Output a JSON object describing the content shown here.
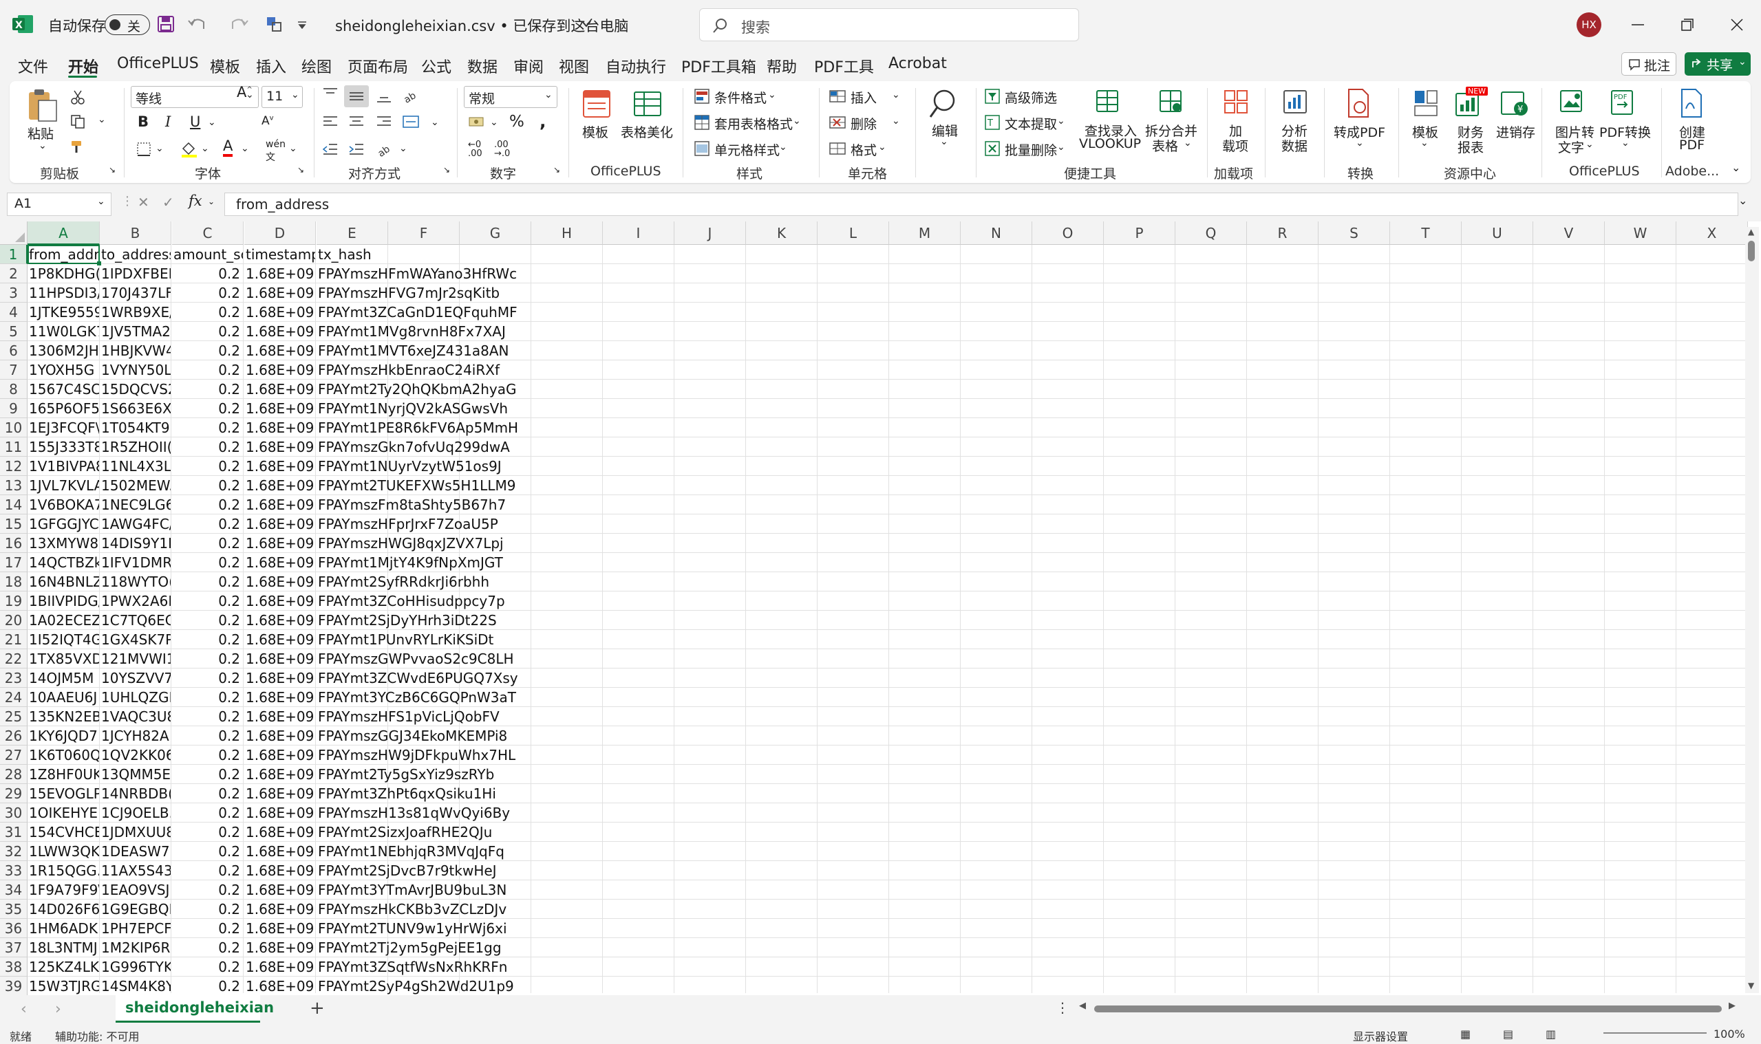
{
  "titlebar": {
    "autosave_label": "自动保存",
    "autosave_state": "关",
    "filename": "sheidongleheixian.csv • 已保存到这台电脑",
    "search_placeholder": "搜索",
    "user_initials": "HX"
  },
  "menu": {
    "items": [
      "文件",
      "开始",
      "OfficePLUS",
      "模板",
      "插入",
      "绘图",
      "页面布局",
      "公式",
      "数据",
      "审阅",
      "视图",
      "自动执行",
      "PDF工具箱",
      "帮助",
      "PDF工具",
      "Acrobat"
    ],
    "active": "开始",
    "comment_label": "批注",
    "share_label": "共享"
  },
  "ribbon": {
    "clipboard": {
      "paste": "粘贴",
      "group": "剪贴板"
    },
    "font": {
      "name": "等线",
      "size": "11",
      "group": "字体"
    },
    "alignment": {
      "group": "对齐方式"
    },
    "number": {
      "format": "常规",
      "group": "数字"
    },
    "officeplus1": {
      "template": "模板",
      "beautify": "表格美化",
      "group": "OfficePLUS"
    },
    "styles": {
      "conditional": "条件格式",
      "table_format": "套用表格格式",
      "cell_style": "单元格样式",
      "group": "样式"
    },
    "cells": {
      "insert": "插入",
      "delete": "删除",
      "format": "格式",
      "group": "单元格"
    },
    "editing": {
      "edit": "编辑"
    },
    "quicktools": {
      "adv_filter": "高级筛选",
      "text_extract": "文本提取",
      "batch_delete": "批量删除",
      "vlookup_1": "查找录入",
      "vlookup_2": "VLOOKUP",
      "split_1": "拆分合并",
      "split_2": "表格",
      "group": "便捷工具"
    },
    "addins": {
      "label_1": "加",
      "label_2": "载项",
      "group": "加载项"
    },
    "analyze": {
      "label_1": "分析",
      "label_2": "数据"
    },
    "convert": {
      "pdf": "转成PDF",
      "group": "转换"
    },
    "resources": {
      "template": "模板",
      "finance_1": "财务",
      "finance_2": "报表",
      "invoice": "进销存",
      "new_badge": "NEW",
      "group": "资源中心"
    },
    "officeplus2": {
      "img_1": "图片转",
      "img_2": "文字",
      "pdf_convert": "PDF转换",
      "group": "OfficePLUS"
    },
    "adobe": {
      "create_1": "创建",
      "create_2": "PDF",
      "group": "Adobe..."
    }
  },
  "formula_bar": {
    "name_box": "A1",
    "fx": "fx",
    "content": "from_address"
  },
  "columns": [
    "A",
    "B",
    "C",
    "D",
    "E",
    "F",
    "G",
    "H",
    "I",
    "J",
    "K",
    "L",
    "M",
    "N",
    "O",
    "P",
    "Q",
    "R",
    "S",
    "T",
    "U",
    "V",
    "W",
    "X"
  ],
  "table": {
    "headers": [
      "from_addr",
      "to_address",
      "amount_sc",
      "timestamp",
      "tx_hash"
    ],
    "rows": [
      [
        "1P8KDHG(",
        "1IPDXFBEF",
        "0.2",
        "1.68E+09",
        "FPAYmszHFmWAYano3HfRWc"
      ],
      [
        "11HPSDI3/",
        "170J437LF",
        "0.2",
        "1.68E+09",
        "FPAYmszHFVG7mJr2sqKitb"
      ],
      [
        "1JTKE9559",
        "1WRB9XE/",
        "0.2",
        "1.68E+09",
        "FPAYmt3ZCaGnD1EQFquhMF"
      ],
      [
        "11W0LGK7",
        "1JV5TMA2",
        "0.2",
        "1.68E+09",
        "FPAYmt1MVg8rvnH8Fx7XAJ"
      ],
      [
        "1306M2JH",
        "1HBJKVW4",
        "0.2",
        "1.68E+09",
        "FPAYmt1MVT6xeJZ431a8AN"
      ],
      [
        "1YOXH5G",
        "1VYNY50L",
        "0.2",
        "1.68E+09",
        "FPAYmszHkbEnraoC24iRXf"
      ],
      [
        "1567C4SC",
        "15DQCVS2",
        "0.2",
        "1.68E+09",
        "FPAYmt2Ty2QhQKbmA2hyaG"
      ],
      [
        "165P6OF5",
        "1S663E6X",
        "0.2",
        "1.68E+09",
        "FPAYmt1NyrjQV2kASGwsVh"
      ],
      [
        "1EJ3FCQF\\",
        "1T054KT93",
        "0.2",
        "1.68E+09",
        "FPAYmt1PE8R6kFV6Ap5MmH"
      ],
      [
        "155J333T8",
        "1R5ZHOII(",
        "0.2",
        "1.68E+09",
        "FPAYmszGkn7ofvUq299dwA"
      ],
      [
        "1V1BIVPA8",
        "11NL4X3L",
        "0.2",
        "1.68E+09",
        "FPAYmt1NUyrVzytW51os9J"
      ],
      [
        "1JVL7KVLA",
        "1502MEW.",
        "0.2",
        "1.68E+09",
        "FPAYmt2TUKEFXWs5H1LLM9"
      ],
      [
        "1V6BOKA7",
        "1NEC9LG6",
        "0.2",
        "1.68E+09",
        "FPAYmszFm8taShty5B67h7"
      ],
      [
        "1GFGGJYC",
        "1AWG4FC/",
        "0.2",
        "1.68E+09",
        "FPAYmszHFprJrxF7ZoaU5P"
      ],
      [
        "13XMYW8",
        "14DIS9Y1F",
        "0.2",
        "1.68E+09",
        "FPAYmszHWGJ8qxJZVX7Lpj"
      ],
      [
        "14QCTBZk",
        "1IFV1DMR",
        "0.2",
        "1.68E+09",
        "FPAYmt1MjtY4K9fNpXmJGT"
      ],
      [
        "16N4BNLZ",
        "118WYTO(",
        "0.2",
        "1.68E+09",
        "FPAYmt2SyfRRdkrJi6rbhh"
      ],
      [
        "1BIIVPIDG/",
        "1PWX2A6I",
        "0.2",
        "1.68E+09",
        "FPAYmt3ZCoHHisudppcy7p"
      ],
      [
        "1A02ECEZ",
        "1C7TQ6EC",
        "0.2",
        "1.68E+09",
        "FPAYmt2SjDyYHrh3iDt22S"
      ],
      [
        "1I52IQT4G",
        "1GX4SK7P",
        "0.2",
        "1.68E+09",
        "FPAYmt1PUnvRYLrKiKSiDt"
      ],
      [
        "1TX85VXD",
        "121MVWI1",
        "0.2",
        "1.68E+09",
        "FPAYmszGWPvvaoS2c9C8LH"
      ],
      [
        "14OJM5M",
        "10YSZVV7",
        "0.2",
        "1.68E+09",
        "FPAYmt3ZCWvdE6PUGQ7Xsy"
      ],
      [
        "10AAEU6J",
        "1UHLQZGI",
        "0.2",
        "1.68E+09",
        "FPAYmt3YCzB6C6GQPnW3aT"
      ],
      [
        "135KN2EB",
        "1VAQC3U8",
        "0.2",
        "1.68E+09",
        "FPAYmszHFS1pVicLjQobFV"
      ],
      [
        "1KY6JQD7",
        "1JCYH82A",
        "0.2",
        "1.68E+09",
        "FPAYmszGGJ34EkoMKEMPi8"
      ],
      [
        "1K6T060Q",
        "1QV2KK06",
        "0.2",
        "1.68E+09",
        "FPAYmszHW9jDFkpuWhx7HL"
      ],
      [
        "1Z8HF0UK",
        "13QMM5E",
        "0.2",
        "1.68E+09",
        "FPAYmt2Ty5gSxYiz9szRYb"
      ],
      [
        "15EVOGLP",
        "14NRBDB(",
        "0.2",
        "1.68E+09",
        "FPAYmt3ZhPt6qxQsiku1Hi"
      ],
      [
        "1OIKEHYE",
        "1CJ9OELB.",
        "0.2",
        "1.68E+09",
        "FPAYmszH13s81qWvQyi6By"
      ],
      [
        "154CVHCE",
        "1JDMXUU8",
        "0.2",
        "1.68E+09",
        "FPAYmt2SizxJoafRHE2QJu"
      ],
      [
        "1LWW3QK",
        "1DEASW75",
        "0.2",
        "1.68E+09",
        "FPAYmt1NEbhjqR3MVqJqFq"
      ],
      [
        "1R15QGG.",
        "11AX5S43",
        "0.2",
        "1.68E+09",
        "FPAYmt2SjDvcB7r9tkwHeJ"
      ],
      [
        "1F9A79F9\\",
        "1EAO9VSJI",
        "0.2",
        "1.68E+09",
        "FPAYmt3YTmAvrJBU9buL3N"
      ],
      [
        "14D026F6",
        "1G9EGBQI",
        "0.2",
        "1.68E+09",
        "FPAYmszHkCKBb3vZCLzDJv"
      ],
      [
        "1HM6ADK",
        "1PH7EPCF",
        "0.2",
        "1.68E+09",
        "FPAYmt2TUNV9w1yHrWj6xi"
      ],
      [
        "18L3NTMJ",
        "1M2KIP6R.",
        "0.2",
        "1.68E+09",
        "FPAYmt2Tj2ym5gPejEE1gg"
      ],
      [
        "125KZ4LKI",
        "1G996TYK",
        "0.2",
        "1.68E+09",
        "FPAYmt3ZSqtfWsNxRhKRFn"
      ],
      [
        "15W3TJRG",
        "14SM4K8Y",
        "0.2",
        "1.68E+09",
        "FPAYmt2SyP4gSh2Wd2U1p9"
      ]
    ]
  },
  "sheet_tabs": {
    "active": "sheidongleheixian",
    "add": "+"
  },
  "status": {
    "ready": "就绪",
    "accessibility": "辅助功能: 不可用",
    "display_settings": "显示器设置",
    "zoom": "100%"
  }
}
